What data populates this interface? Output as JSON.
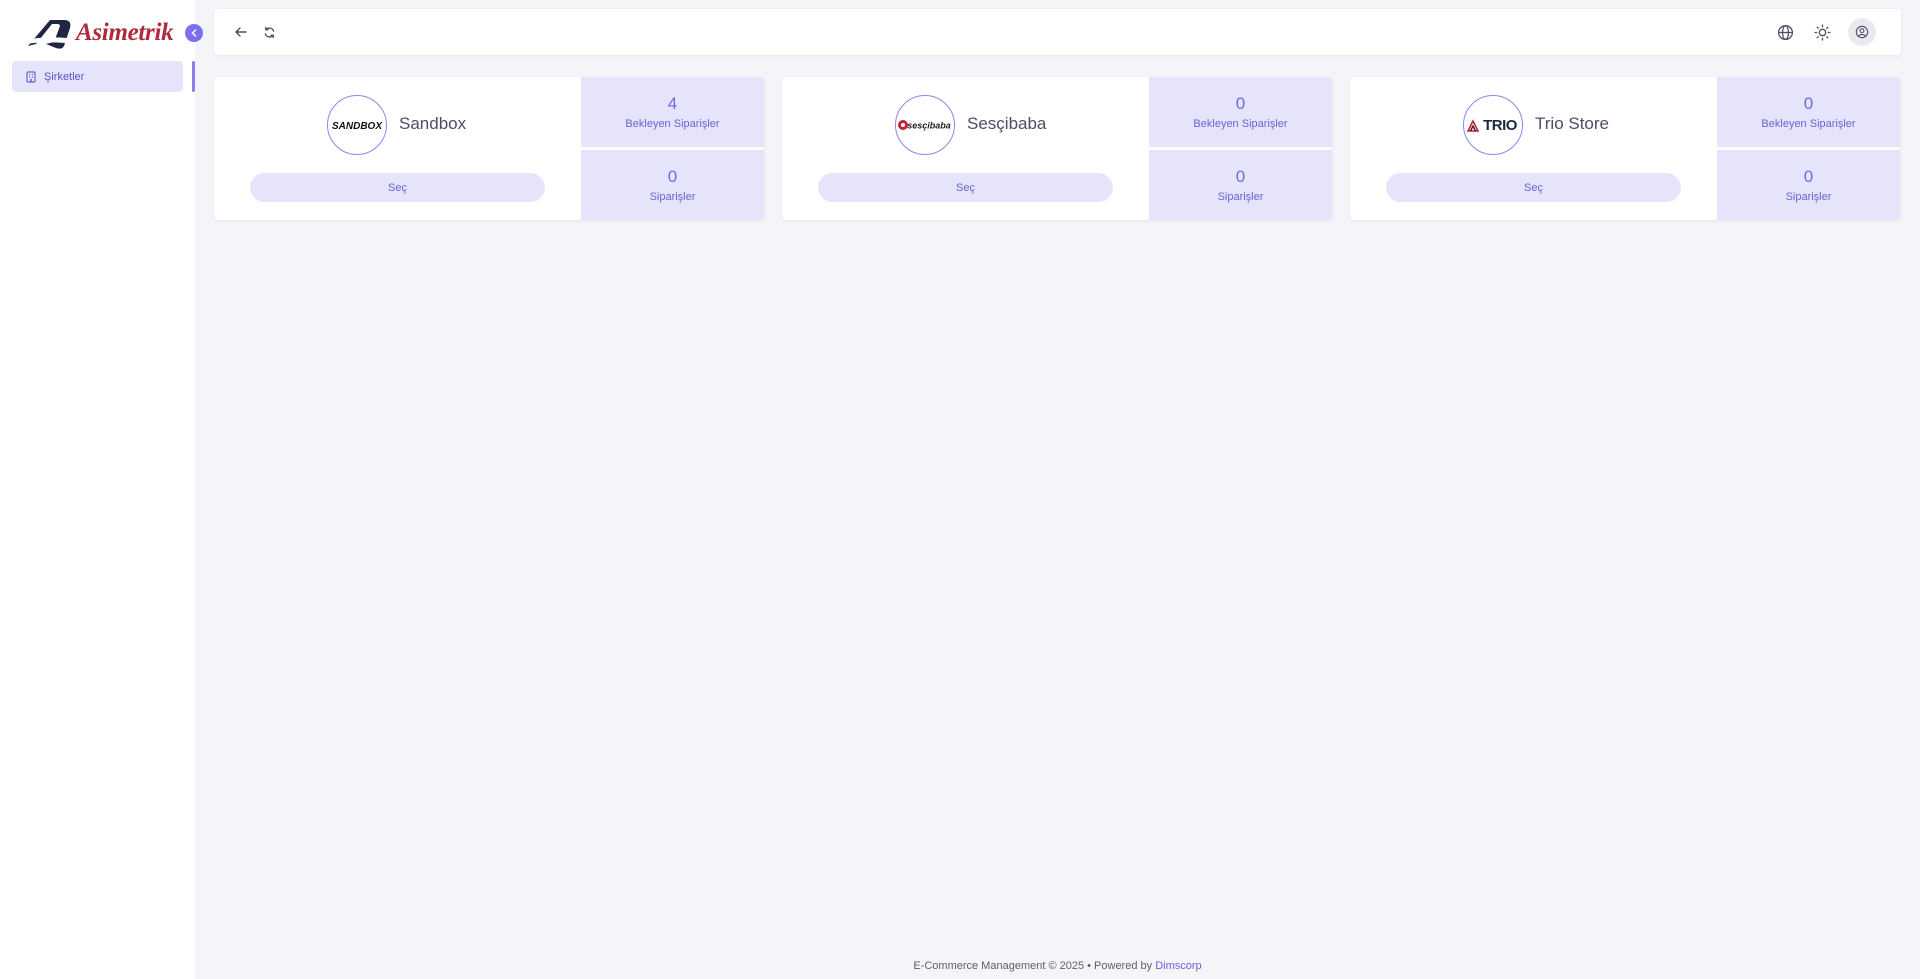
{
  "brand": {
    "name": "Asimetrik",
    "color": "#b12a3c",
    "accent": "#7b6ff0"
  },
  "sidebar": {
    "items": [
      {
        "label": "Şirketler",
        "icon": "building-icon",
        "active": true
      }
    ]
  },
  "topbar": {
    "icons": [
      "arrow-left-icon",
      "refresh-icon",
      "globe-icon",
      "sun-icon",
      "user-circle-icon"
    ]
  },
  "companies": [
    {
      "name": "Sandbox",
      "logo_text": "SANDBOX",
      "select_label": "Seç",
      "pending_orders": {
        "value": "4",
        "label": "Bekleyen Siparişler"
      },
      "orders": {
        "value": "0",
        "label": "Siparişler"
      }
    },
    {
      "name": "Sesçibaba",
      "logo_text": "sesçibaba",
      "select_label": "Seç",
      "pending_orders": {
        "value": "0",
        "label": "Bekleyen Siparişler"
      },
      "orders": {
        "value": "0",
        "label": "Siparişler"
      }
    },
    {
      "name": "Trio Store",
      "logo_text": "TRIO",
      "select_label": "Seç",
      "pending_orders": {
        "value": "0",
        "label": "Bekleyen Siparişler"
      },
      "orders": {
        "value": "0",
        "label": "Siparişler"
      }
    }
  ],
  "footer": {
    "text": "E-Commerce Management © 2025 • Powered by",
    "link": "Dimscorp"
  }
}
